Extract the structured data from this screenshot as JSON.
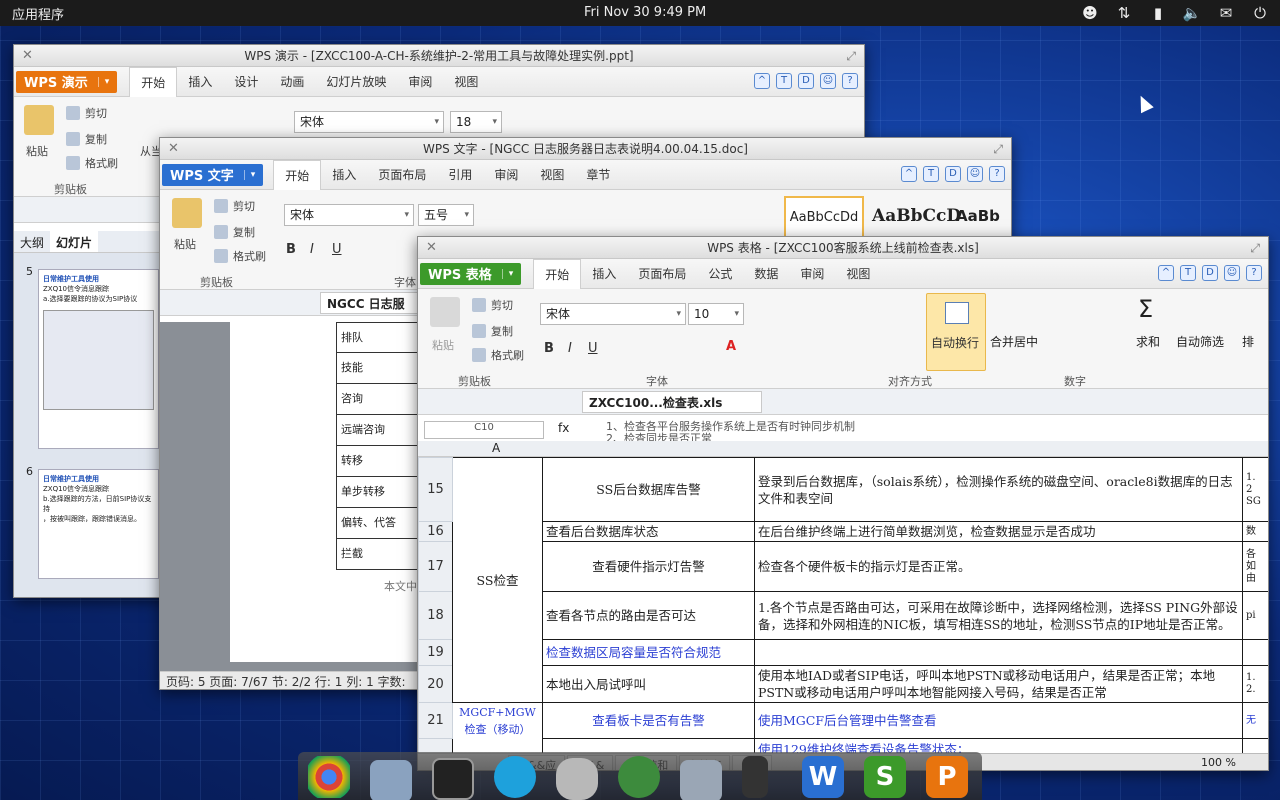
{
  "topbar": {
    "apps": "应用程序",
    "clock": "Fri Nov 30  9:49 PM"
  },
  "win_ppt": {
    "title": "WPS 演示 - [ZXCC100-A-CH-系统维护-2-常用工具与故障处理实例.ppt]",
    "app": "WPS 演示",
    "tabs": [
      "开始",
      "插入",
      "设计",
      "动画",
      "幻灯片放映",
      "审阅",
      "视图"
    ],
    "paste": "粘贴",
    "cut": "剪切",
    "copy": "复制",
    "fmt": "格式刷",
    "clipboard": "剪贴板",
    "cong": "从当",
    "font": "宋体",
    "size": "18",
    "panel_tabs": [
      "大纲",
      "幻灯片"
    ],
    "slide5_num": "5",
    "slide5_title": "日常维护工具使用",
    "slide5_l1": "ZXQ10信令消息跟踪",
    "slide5_l2": "a.选择要跟踪的协议为SIP协议",
    "slide6_num": "6",
    "slide6_title": "日常维护工具使用",
    "slide6_l1": "ZXQ10信令消息跟踪",
    "slide6_l2": "b.选择跟踪的方法，日前SIP协议支持",
    "slide6_l3": "，按被叫跟踪，跟踪错误消息。"
  },
  "win_doc": {
    "title": "WPS 文字 - [NGCC 日志服务器日志表说明4.00.04.15.doc]",
    "app": "WPS 文字",
    "tabs": [
      "开始",
      "插入",
      "页面布局",
      "引用",
      "审阅",
      "视图",
      "章节"
    ],
    "paste": "粘贴",
    "cut": "剪切",
    "copy": "复制",
    "fmt": "格式刷",
    "clipboard": "剪贴板",
    "font": "宋体",
    "size": "五号",
    "font_label": "字体",
    "styles": [
      "AaBbCcDd",
      "AaBbCcD",
      "AaBb"
    ],
    "tab_file": "NGCC 日志服",
    "rows": [
      "排队",
      "技能",
      "咨询",
      "远端咨询",
      "转移",
      "单步转移",
      "偏转、代答",
      "拦截"
    ],
    "body_hint": "本文中",
    "status": "页码: 5  页面: 7/67  节: 2/2  行: 1  列: 1  字数:"
  },
  "win_xls": {
    "title": "WPS 表格 - [ZXCC100客服系统上线前检查表.xls]",
    "app": "WPS 表格",
    "tabs": [
      "开始",
      "插入",
      "页面布局",
      "公式",
      "数据",
      "审阅",
      "视图"
    ],
    "paste": "粘贴",
    "cut": "剪切",
    "copy": "复制",
    "fmt": "格式刷",
    "clipboard": "剪贴板",
    "font": "宋体",
    "size": "10",
    "font_label": "字体",
    "align_label": "对齐方式",
    "num_label": "数字",
    "wrap": "自动换行",
    "merge": "合并居中",
    "sum": "求和",
    "filter": "自动筛选",
    "sort": "排",
    "tab_file": "ZXCC100...检查表.xls",
    "cell_ref": "C10",
    "formula_l1": "1、检查各平台服务操作系统上是否有时钟同步机制",
    "formula_l2": "2、检查同步是否正常",
    "col_a": "A",
    "group1": "SS检查",
    "group2": "MGCF+MGW检查（移动）",
    "rows": [
      {
        "n": "15",
        "b": "SS后台数据库告警",
        "c": "登录到后台数据库，（solais系统），检测操作系统的磁盘空间、oracle8i数据库的日志文件和表空间",
        "d": "1.\n2\nSG"
      },
      {
        "n": "16",
        "b": "查看后台数据库状态",
        "c": "在后台维护终端上进行简单数据浏览，检查数据显示是否成功",
        "d": "数"
      },
      {
        "n": "17",
        "b": "查看硬件指示灯告警",
        "c": "检查各个硬件板卡的指示灯是否正常。",
        "d": "各\n如\n由"
      },
      {
        "n": "18",
        "b": "查看各节点的路由是否可达",
        "c": "1.各个节点是否路由可达，可采用在故障诊断中，选择网络检测，选择SS PING外部设备，选择和外网相连的NIC板，填写相连SS的地址，检测SS节点的IP地址是否正常。",
        "d": "pi"
      },
      {
        "n": "19",
        "b": "检查数据区局容量是否符合规范",
        "c": "",
        "d": ""
      },
      {
        "n": "20",
        "b": "本地出入局试呼叫",
        "c": "使用本地IAD或者SIP电话，呼叫本地PSTN或移动电话用户，结果是否正常；本地PSTN或移动电话用户呼叫本地智能网接入号码，结果是否正常",
        "d": "1.\n2."
      },
      {
        "n": "21",
        "b": "查看板卡是否有告警",
        "c": "使用MGCF后台管理中告警查看",
        "d": "无"
      },
      {
        "n": "",
        "b": "",
        "c": "使用129维护终端查看设备告警状态；",
        "d": ""
      }
    ],
    "sheet_tabs": [
      "件&&应",
      "备&&",
      "卡系统和",
      "车检查",
      "参数"
    ],
    "zoom": "100 %"
  },
  "colors": {
    "ppt": "#e8740e",
    "doc": "#2a6fd1",
    "xls": "#3c9a2a",
    "blue_text": "#2b3fd3"
  }
}
